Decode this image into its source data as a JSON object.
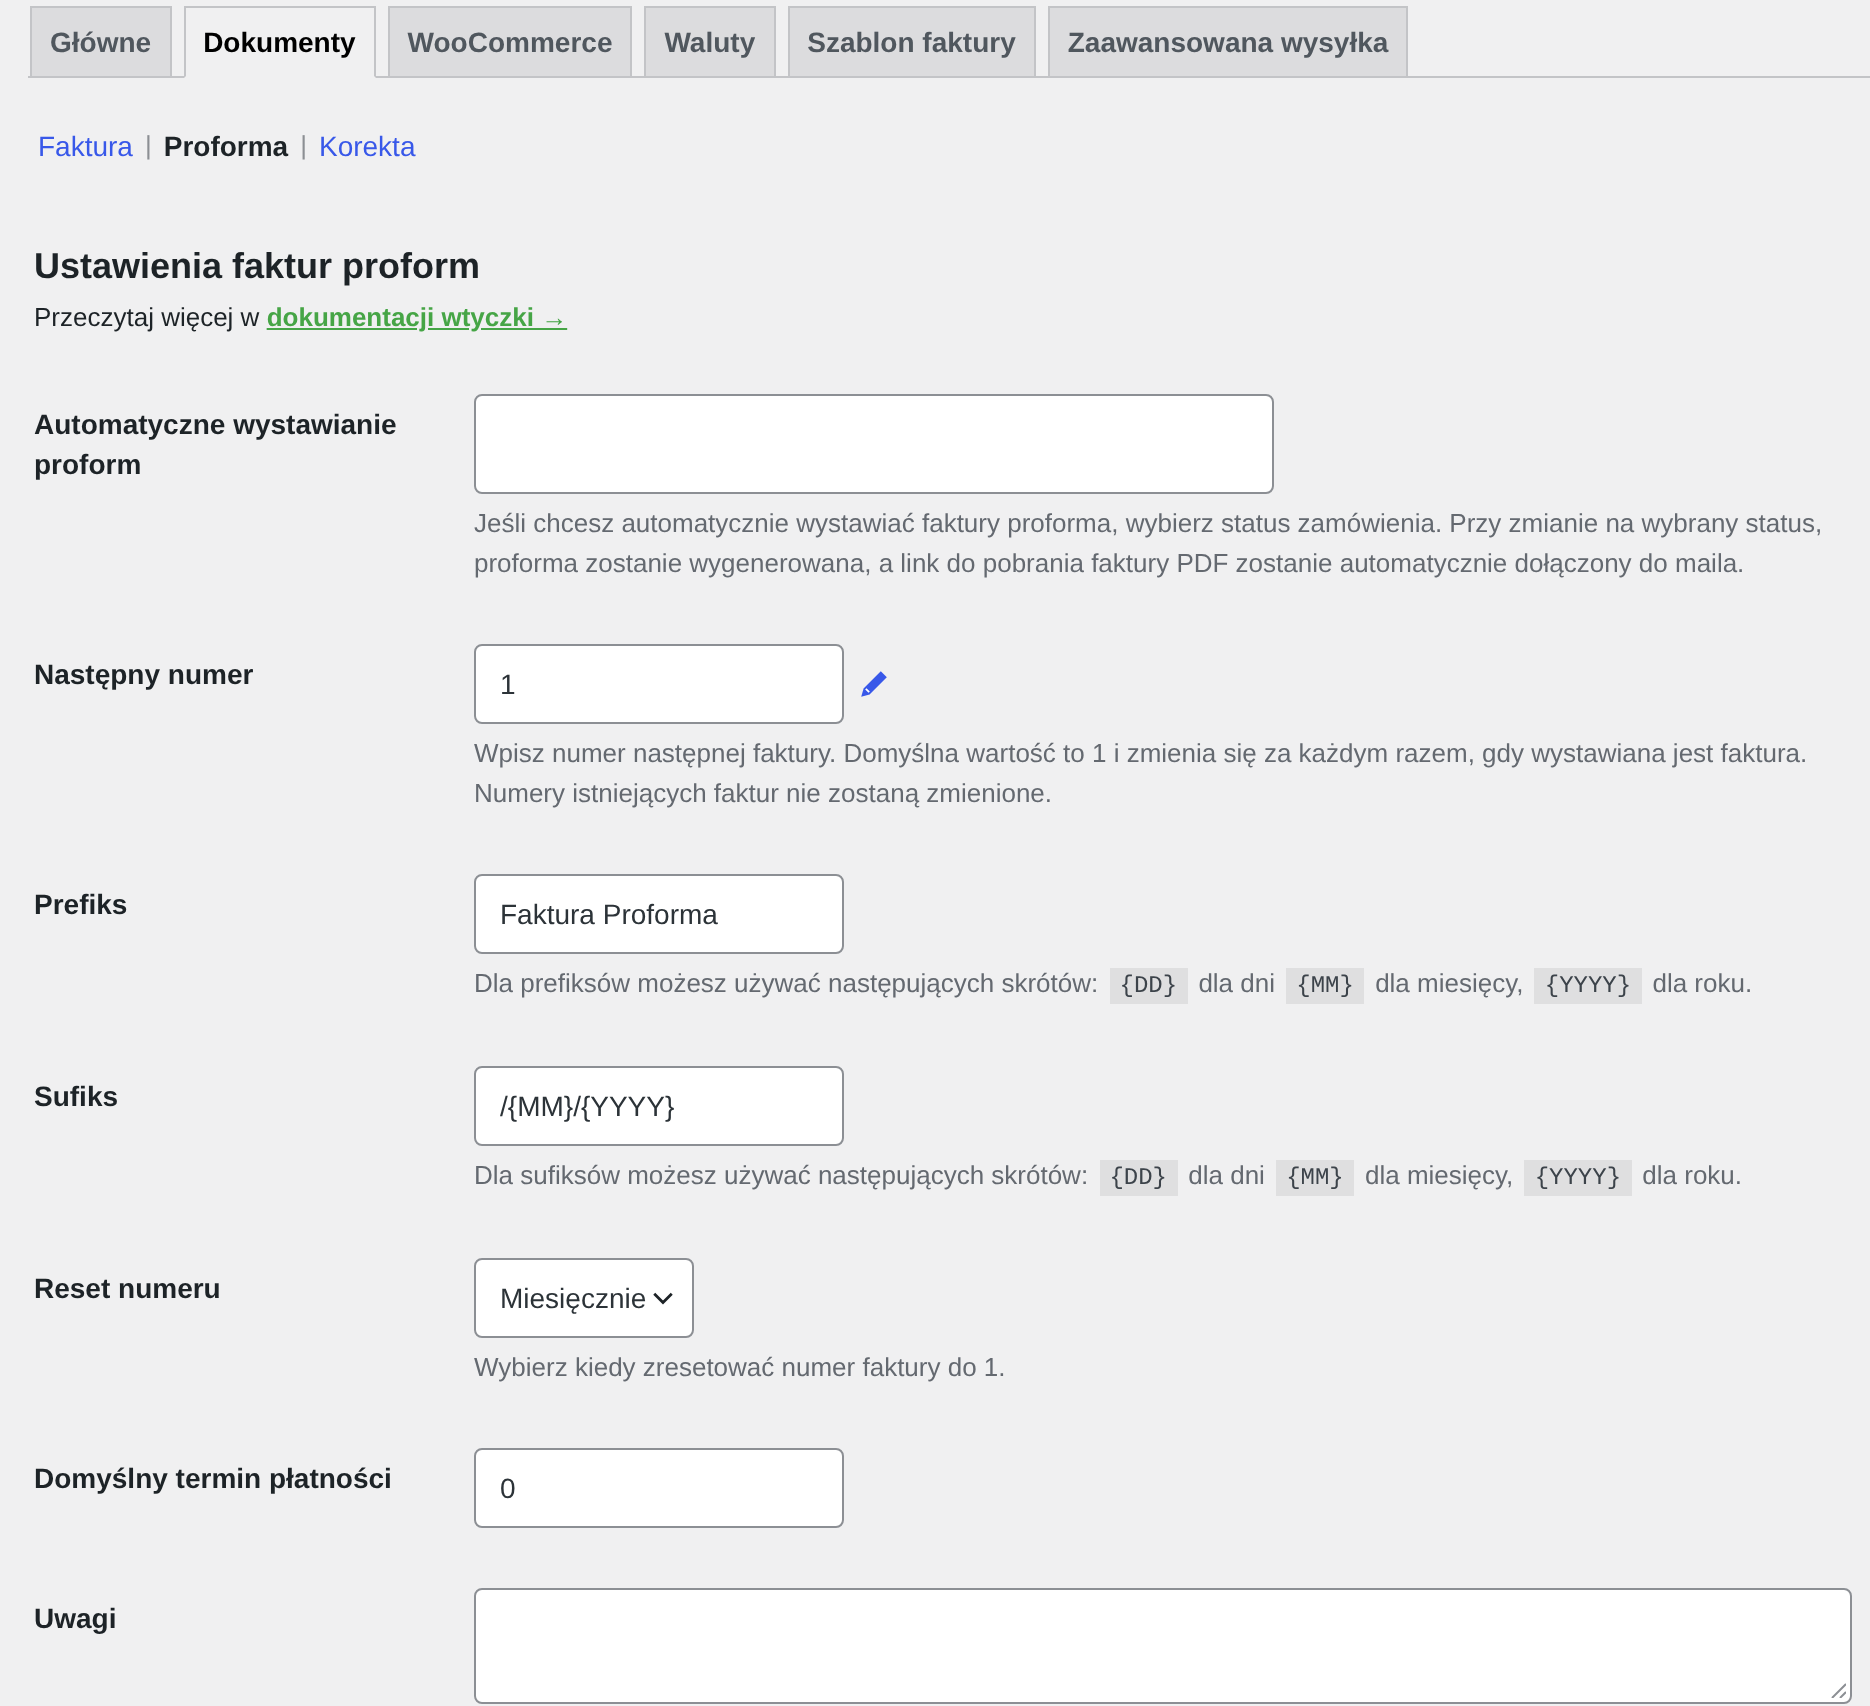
{
  "tabs": [
    {
      "label": "Główne",
      "selected": false
    },
    {
      "label": "Dokumenty",
      "selected": true
    },
    {
      "label": "WooCommerce",
      "selected": false
    },
    {
      "label": "Waluty",
      "selected": false
    },
    {
      "label": "Szablon faktury",
      "selected": false
    },
    {
      "label": "Zaawansowana wysyłka",
      "selected": false
    }
  ],
  "subnav": [
    {
      "kind": "link",
      "label": "Faktura",
      "selected": false
    },
    {
      "kind": "separator",
      "text": "|"
    },
    {
      "kind": "link",
      "label": "Proforma",
      "selected": true
    },
    {
      "kind": "separator",
      "text": "|"
    },
    {
      "kind": "link",
      "label": "Korekta",
      "selected": false
    }
  ],
  "section": {
    "title": "Ustawienia faktur proform",
    "intro": {
      "text": "Przeczytaj więcej w",
      "link": "dokumentacji wtyczki →"
    }
  },
  "fields": [
    {
      "kind": "multiselect",
      "label": "Automatyczne wystawianie proform",
      "description": [
        {
          "kind": "text",
          "text": "Jeśli chcesz automatycznie wystawiać faktury proforma, wybierz status zamówienia. Przy zmianie na wybrany status, proforma zostanie wygenerowana, a link do pobrania faktury PDF zostanie automatycznie dołączony do maila."
        }
      ]
    },
    {
      "kind": "text",
      "label": "Następny numer",
      "value": "1",
      "edit_icon": true,
      "description": [
        {
          "kind": "text",
          "text": "Wpisz numer następnej faktury. Domyślna wartość to 1 i zmienia się za każdym razem, gdy wystawiana jest faktura. Numery istniejących faktur nie zostaną zmienione."
        }
      ]
    },
    {
      "kind": "text",
      "label": "Prefiks",
      "value": "Faktura Proforma",
      "description": [
        {
          "kind": "text",
          "text": "Dla prefiksów możesz używać następujących skrótów:"
        },
        {
          "kind": "code",
          "text": "{DD}"
        },
        {
          "kind": "text",
          "text": "dla dni"
        },
        {
          "kind": "code",
          "text": "{MM}"
        },
        {
          "kind": "text",
          "text": "dla miesięcy,"
        },
        {
          "kind": "code",
          "text": "{YYYY}"
        },
        {
          "kind": "text",
          "text": "dla roku."
        }
      ]
    },
    {
      "kind": "text",
      "label": "Sufiks",
      "value": "/{MM}/{YYYY}",
      "description": [
        {
          "kind": "text",
          "text": "Dla sufiksów możesz używać następujących skrótów:"
        },
        {
          "kind": "code",
          "text": "{DD}"
        },
        {
          "kind": "text",
          "text": "dla dni"
        },
        {
          "kind": "code",
          "text": "{MM}"
        },
        {
          "kind": "text",
          "text": "dla miesięcy,"
        },
        {
          "kind": "code",
          "text": "{YYYY}"
        },
        {
          "kind": "text",
          "text": "dla roku."
        }
      ]
    },
    {
      "kind": "select",
      "label": "Reset numeru",
      "value": "Miesięcznie",
      "description": [
        {
          "kind": "text",
          "text": "Wybierz kiedy zresetować numer faktury do 1."
        }
      ]
    },
    {
      "kind": "text",
      "label": "Domyślny termin płatności",
      "value": "0"
    },
    {
      "kind": "textarea",
      "label": "Uwagi"
    }
  ]
}
